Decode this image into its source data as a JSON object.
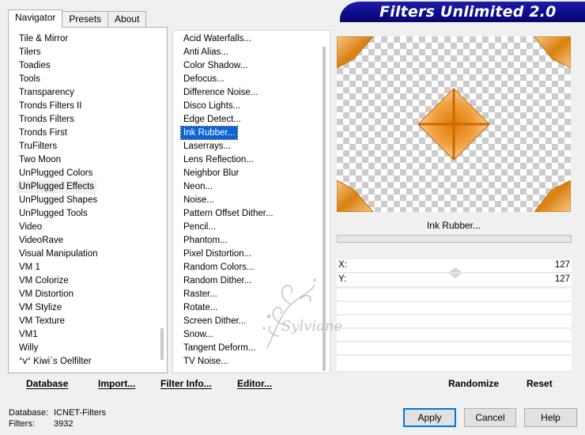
{
  "tabs": [
    "Navigator",
    "Presets",
    "About"
  ],
  "app_title": "Filters Unlimited 2.0",
  "categories": [
    "Tile & Mirror",
    "Tilers",
    "Toadies",
    "Tools",
    "Transparency",
    "Tronds Filters II",
    "Tronds Filters",
    "Tronds First",
    "TruFilters",
    "Two Moon",
    "UnPlugged Colors",
    "UnPlugged Effects",
    "UnPlugged Shapes",
    "UnPlugged Tools",
    "Video",
    "VideoRave",
    "Visual Manipulation",
    "VM 1",
    "VM Colorize",
    "VM Distortion",
    "VM Stylize",
    "VM Texture",
    "VM1",
    "Willy",
    "°v° Kiwi`s Oelfilter"
  ],
  "selected_category": "UnPlugged Effects",
  "filters": [
    "Acid Waterfalls...",
    "Anti Alias...",
    "Color Shadow...",
    "Defocus...",
    "Difference Noise...",
    "Disco Lights...",
    "Edge Detect...",
    "Ink Rubber...",
    "Laserrays...",
    "Lens Reflection...",
    "Neighbor Blur",
    "Neon...",
    "Noise...",
    "Pattern Offset Dither...",
    "Pencil...",
    "Phantom...",
    "Pixel Distortion...",
    "Random Colors...",
    "Random Dither...",
    "Raster...",
    "Rotate...",
    "Screen Dither...",
    "Snow...",
    "Tangent Deform...",
    "TV Noise..."
  ],
  "selected_filter": "Ink Rubber...",
  "current_filter_name": "Ink Rubber...",
  "params": [
    {
      "label": "X:",
      "value": "127"
    },
    {
      "label": "Y:",
      "value": "127"
    }
  ],
  "watermark_text": "Sylviane",
  "toolbar_left": {
    "database": "Database",
    "import": "Import...",
    "filter_info": "Filter Info...",
    "editor": "Editor..."
  },
  "toolbar_right": {
    "randomize": "Randomize",
    "reset": "Reset"
  },
  "status": {
    "database_label": "Database:",
    "database_value": "ICNET-Filters",
    "filters_label": "Filters:",
    "filters_value": "3932"
  },
  "buttons": {
    "apply": "Apply",
    "cancel": "Cancel",
    "help": "Help"
  },
  "colors": {
    "banner": "#0c0c8a",
    "selection": "#0a64d8",
    "preview_orange": "#d9800f"
  }
}
